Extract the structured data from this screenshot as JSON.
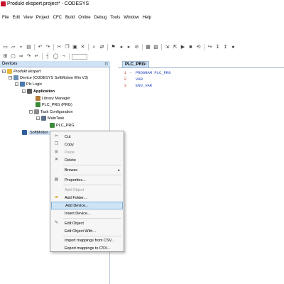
{
  "window": {
    "title": "Produkt ekspert.project* - CODESYS"
  },
  "menu": [
    "File",
    "Edit",
    "View",
    "Project",
    "CFC",
    "Build",
    "Online",
    "Debug",
    "Tools",
    "Window",
    "Help"
  ],
  "devices_pane": {
    "title": "Devices",
    "tree": [
      {
        "label": "Produkt ekspert",
        "style": "italic",
        "icon": "project-icon"
      },
      {
        "label": "Device (CODESYS SoftMotion Win V3)",
        "icon": "device-icon"
      },
      {
        "label": "Plc Logic",
        "icon": "plc-logic-icon"
      },
      {
        "label": "Application",
        "style": "bold",
        "icon": "application-icon"
      },
      {
        "label": "Library Manager",
        "icon": "library-manager-icon"
      },
      {
        "label": "PLC_PRG (PRG)",
        "icon": "program-icon"
      },
      {
        "label": "Task Configuration",
        "icon": "task-configuration-icon"
      },
      {
        "label": "MainTask",
        "icon": "task-icon"
      },
      {
        "label": "PLC_PRG",
        "icon": "program-call-icon"
      },
      {
        "label": "SoftMotion Ge",
        "icon": "softmotion-icon",
        "selected": true
      }
    ]
  },
  "editor": {
    "tab_title": "PLC_PRG",
    "tab_close": "×",
    "lines": [
      {
        "num": "1",
        "text": "PROGRAM PLC_PRG"
      },
      {
        "num": "2",
        "text": "VAR"
      },
      {
        "num": "3",
        "text": "END_VAR"
      }
    ]
  },
  "context_menu": {
    "items": [
      {
        "label": "Cut",
        "icon": "scissors-icon",
        "enabled": true
      },
      {
        "label": "Copy",
        "icon": "copy-icon",
        "enabled": true
      },
      {
        "label": "Paste",
        "icon": "paste-icon",
        "enabled": false
      },
      {
        "label": "Delete",
        "icon": "delete-icon",
        "enabled": true
      },
      {
        "label": "Browse",
        "submenu": true,
        "enabled": true
      },
      {
        "label": "Properties...",
        "icon": "properties-icon",
        "enabled": true
      },
      {
        "label": "Add Object",
        "enabled": false
      },
      {
        "label": "Add Folder...",
        "icon": "folder-icon",
        "enabled": true
      },
      {
        "label": "Add Device...",
        "enabled": true,
        "highlighted": true
      },
      {
        "label": "Insert Device...",
        "enabled": true
      },
      {
        "label": "Edit Object",
        "icon": "edit-object-icon",
        "enabled": true
      },
      {
        "label": "Edit Object With...",
        "enabled": true
      },
      {
        "label": "Import mappings from CSV...",
        "enabled": true
      },
      {
        "label": "Export mappings to CSV...",
        "enabled": true
      }
    ]
  },
  "colors": {
    "pane_header": "#cfe2f6",
    "highlight": "#cde4f7",
    "keyword": "#1f3fbf",
    "line_number": "#c0392b",
    "app_icon": "#c8102e"
  }
}
